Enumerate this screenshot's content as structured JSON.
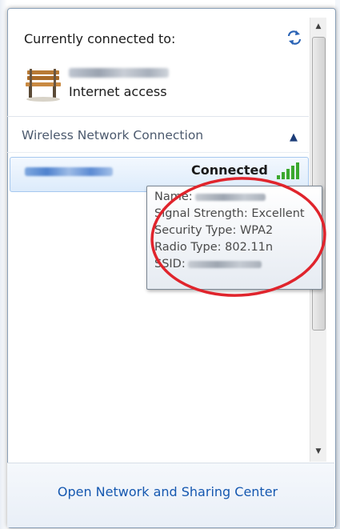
{
  "panel": {
    "connected_header": "Currently connected to:",
    "current_network": {
      "access_status": "Internet access",
      "icon": "bench-icon"
    },
    "refresh_icon": "refresh-icon"
  },
  "section": {
    "title": "Wireless Network Connection",
    "chevron": "chevron-up-icon",
    "networks": [
      {
        "status": "Connected",
        "signal_icon": "signal-strength-icon"
      }
    ]
  },
  "tooltip": {
    "name_label": "Name:",
    "signal_strength": "Signal Strength: Excellent",
    "security_type": "Security Type: WPA2",
    "radio_type": "Radio Type: 802.11n",
    "ssid_label": "SSID:"
  },
  "footer": {
    "link": "Open Network and Sharing Center"
  },
  "colors": {
    "link": "#1558b0",
    "accent": "#1c3d78",
    "highlight": "#e0242c",
    "signal": "#3aa82e"
  }
}
